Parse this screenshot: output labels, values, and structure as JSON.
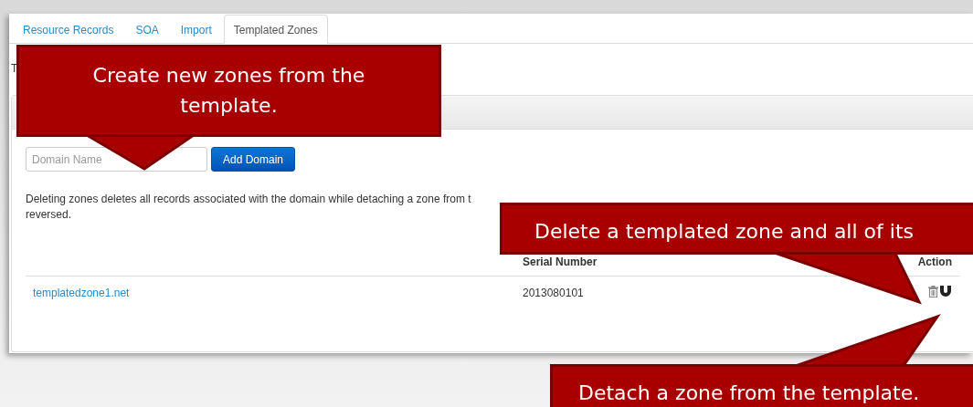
{
  "tabs": [
    {
      "label": "Resource Records",
      "selected": false
    },
    {
      "label": "SOA",
      "selected": false
    },
    {
      "label": "Import",
      "selected": false
    },
    {
      "label": "Templated Zones",
      "selected": true
    }
  ],
  "heading_fragment": "T",
  "domain_field": {
    "placeholder": "Domain Name"
  },
  "add_button": "Add Domain",
  "description_lines": [
    "Deleting zones deletes all records associated with the domain while detaching a zone from t",
    "reversed."
  ],
  "table": {
    "columns": [
      {
        "label": "Serial Number"
      },
      {
        "label": "Action"
      }
    ],
    "rows": [
      {
        "domain": "templatedzone1.net",
        "serial": "2013080101"
      }
    ]
  },
  "callouts": [
    {
      "text": "Create new zones from the template."
    },
    {
      "text": "Delete a templated zone and all of its"
    },
    {
      "text": "Detach a zone from the template."
    }
  ]
}
